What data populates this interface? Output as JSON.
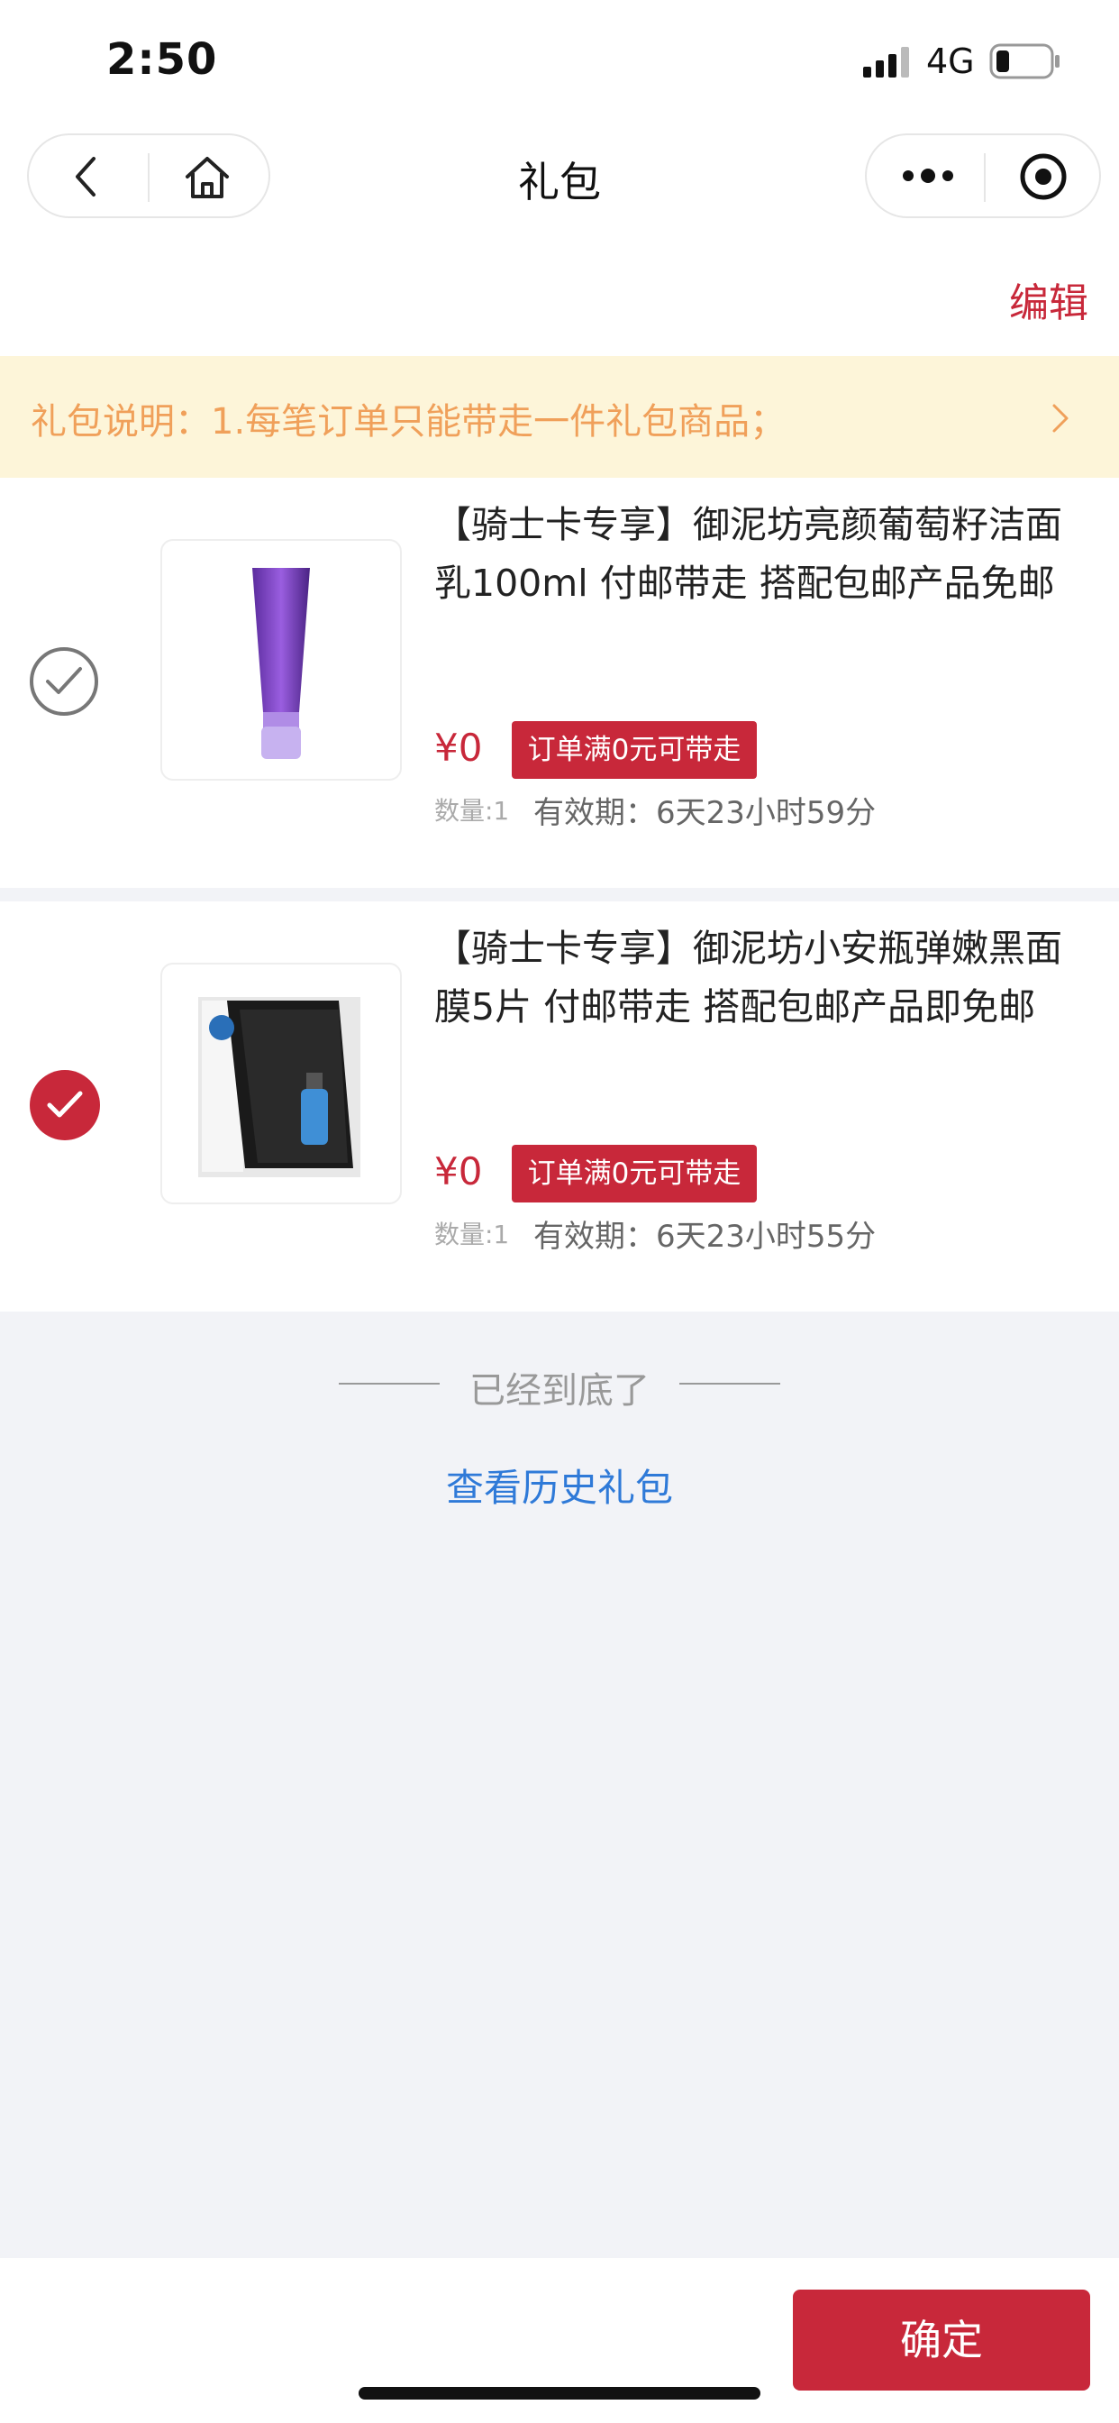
{
  "status_bar": {
    "time": "2:50",
    "network": "4G"
  },
  "nav": {
    "title": "礼包",
    "icons": {
      "back": "back-icon",
      "home": "home-icon",
      "more": "more-icon",
      "close": "target-icon"
    }
  },
  "edit_label": "编辑",
  "notice": {
    "text": "礼包说明：1.每笔订单只能带走一件礼包商品；"
  },
  "products": [
    {
      "title": "【骑士卡专享】御泥坊亮颜葡萄籽洁面乳100ml 付邮带走 搭配包邮产品免邮",
      "price": "¥0",
      "tag": "订单满0元可带走",
      "quantity": "数量:1",
      "validity": "有效期：6天23小时59分",
      "selected": false
    },
    {
      "title": "【骑士卡专享】御泥坊小安瓶弹嫩黑面膜5片 付邮带走 搭配包邮产品即免邮",
      "price": "¥0",
      "tag": "订单满0元可带走",
      "quantity": "数量:1",
      "validity": "有效期：6天23小时55分",
      "selected": true
    }
  ],
  "end_text": "已经到底了",
  "history_link": "查看历史礼包",
  "confirm_label": "确定",
  "colors": {
    "accent": "#c8283a",
    "notice_bg": "#fdf5d9",
    "notice_text": "#f0a05a",
    "link": "#2f7ad8"
  }
}
